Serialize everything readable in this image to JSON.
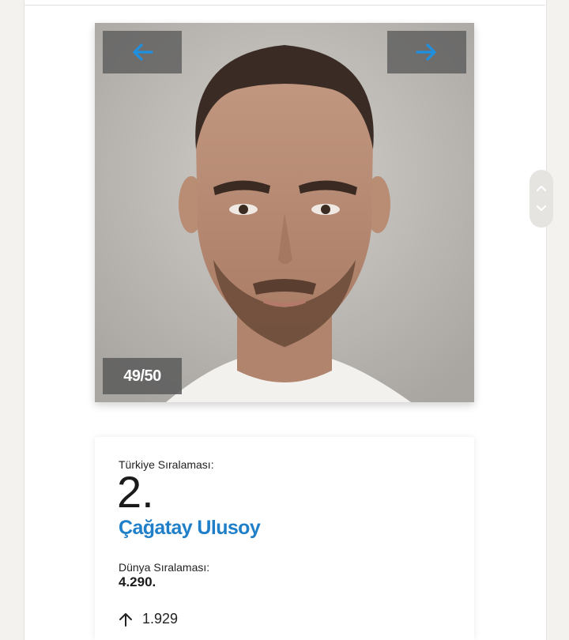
{
  "gallery": {
    "counter": "49/50",
    "prev_icon": "arrow-left-icon",
    "next_icon": "arrow-right-icon",
    "arrow_color": "#1f8fe0"
  },
  "scroll": {
    "up_icon": "chevron-up-icon",
    "down_icon": "chevron-down-icon"
  },
  "card": {
    "turkey_rank_label": "Türkiye Sıralaması:",
    "turkey_rank_value": "2.",
    "person_name": "Çağatay Ulusoy",
    "world_rank_label": "Dünya Sıralaması:",
    "world_rank_value": "4.290.",
    "change_icon": "arrow-up-icon",
    "change_value": "1.929",
    "link_color": "#1f7fc8"
  }
}
